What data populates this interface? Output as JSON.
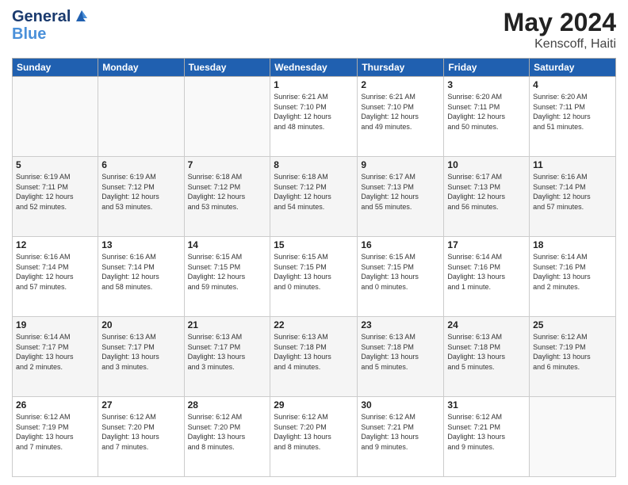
{
  "header": {
    "logo_line1": "General",
    "logo_line2": "Blue",
    "main_title": "May 2024",
    "subtitle": "Kenscoff, Haiti"
  },
  "columns": [
    "Sunday",
    "Monday",
    "Tuesday",
    "Wednesday",
    "Thursday",
    "Friday",
    "Saturday"
  ],
  "weeks": [
    [
      {
        "num": "",
        "info": ""
      },
      {
        "num": "",
        "info": ""
      },
      {
        "num": "",
        "info": ""
      },
      {
        "num": "1",
        "info": "Sunrise: 6:21 AM\nSunset: 7:10 PM\nDaylight: 12 hours\nand 48 minutes."
      },
      {
        "num": "2",
        "info": "Sunrise: 6:21 AM\nSunset: 7:10 PM\nDaylight: 12 hours\nand 49 minutes."
      },
      {
        "num": "3",
        "info": "Sunrise: 6:20 AM\nSunset: 7:11 PM\nDaylight: 12 hours\nand 50 minutes."
      },
      {
        "num": "4",
        "info": "Sunrise: 6:20 AM\nSunset: 7:11 PM\nDaylight: 12 hours\nand 51 minutes."
      }
    ],
    [
      {
        "num": "5",
        "info": "Sunrise: 6:19 AM\nSunset: 7:11 PM\nDaylight: 12 hours\nand 52 minutes."
      },
      {
        "num": "6",
        "info": "Sunrise: 6:19 AM\nSunset: 7:12 PM\nDaylight: 12 hours\nand 53 minutes."
      },
      {
        "num": "7",
        "info": "Sunrise: 6:18 AM\nSunset: 7:12 PM\nDaylight: 12 hours\nand 53 minutes."
      },
      {
        "num": "8",
        "info": "Sunrise: 6:18 AM\nSunset: 7:12 PM\nDaylight: 12 hours\nand 54 minutes."
      },
      {
        "num": "9",
        "info": "Sunrise: 6:17 AM\nSunset: 7:13 PM\nDaylight: 12 hours\nand 55 minutes."
      },
      {
        "num": "10",
        "info": "Sunrise: 6:17 AM\nSunset: 7:13 PM\nDaylight: 12 hours\nand 56 minutes."
      },
      {
        "num": "11",
        "info": "Sunrise: 6:16 AM\nSunset: 7:14 PM\nDaylight: 12 hours\nand 57 minutes."
      }
    ],
    [
      {
        "num": "12",
        "info": "Sunrise: 6:16 AM\nSunset: 7:14 PM\nDaylight: 12 hours\nand 57 minutes."
      },
      {
        "num": "13",
        "info": "Sunrise: 6:16 AM\nSunset: 7:14 PM\nDaylight: 12 hours\nand 58 minutes."
      },
      {
        "num": "14",
        "info": "Sunrise: 6:15 AM\nSunset: 7:15 PM\nDaylight: 12 hours\nand 59 minutes."
      },
      {
        "num": "15",
        "info": "Sunrise: 6:15 AM\nSunset: 7:15 PM\nDaylight: 13 hours\nand 0 minutes."
      },
      {
        "num": "16",
        "info": "Sunrise: 6:15 AM\nSunset: 7:15 PM\nDaylight: 13 hours\nand 0 minutes."
      },
      {
        "num": "17",
        "info": "Sunrise: 6:14 AM\nSunset: 7:16 PM\nDaylight: 13 hours\nand 1 minute."
      },
      {
        "num": "18",
        "info": "Sunrise: 6:14 AM\nSunset: 7:16 PM\nDaylight: 13 hours\nand 2 minutes."
      }
    ],
    [
      {
        "num": "19",
        "info": "Sunrise: 6:14 AM\nSunset: 7:17 PM\nDaylight: 13 hours\nand 2 minutes."
      },
      {
        "num": "20",
        "info": "Sunrise: 6:13 AM\nSunset: 7:17 PM\nDaylight: 13 hours\nand 3 minutes."
      },
      {
        "num": "21",
        "info": "Sunrise: 6:13 AM\nSunset: 7:17 PM\nDaylight: 13 hours\nand 3 minutes."
      },
      {
        "num": "22",
        "info": "Sunrise: 6:13 AM\nSunset: 7:18 PM\nDaylight: 13 hours\nand 4 minutes."
      },
      {
        "num": "23",
        "info": "Sunrise: 6:13 AM\nSunset: 7:18 PM\nDaylight: 13 hours\nand 5 minutes."
      },
      {
        "num": "24",
        "info": "Sunrise: 6:13 AM\nSunset: 7:18 PM\nDaylight: 13 hours\nand 5 minutes."
      },
      {
        "num": "25",
        "info": "Sunrise: 6:12 AM\nSunset: 7:19 PM\nDaylight: 13 hours\nand 6 minutes."
      }
    ],
    [
      {
        "num": "26",
        "info": "Sunrise: 6:12 AM\nSunset: 7:19 PM\nDaylight: 13 hours\nand 7 minutes."
      },
      {
        "num": "27",
        "info": "Sunrise: 6:12 AM\nSunset: 7:20 PM\nDaylight: 13 hours\nand 7 minutes."
      },
      {
        "num": "28",
        "info": "Sunrise: 6:12 AM\nSunset: 7:20 PM\nDaylight: 13 hours\nand 8 minutes."
      },
      {
        "num": "29",
        "info": "Sunrise: 6:12 AM\nSunset: 7:20 PM\nDaylight: 13 hours\nand 8 minutes."
      },
      {
        "num": "30",
        "info": "Sunrise: 6:12 AM\nSunset: 7:21 PM\nDaylight: 13 hours\nand 9 minutes."
      },
      {
        "num": "31",
        "info": "Sunrise: 6:12 AM\nSunset: 7:21 PM\nDaylight: 13 hours\nand 9 minutes."
      },
      {
        "num": "",
        "info": ""
      }
    ]
  ]
}
